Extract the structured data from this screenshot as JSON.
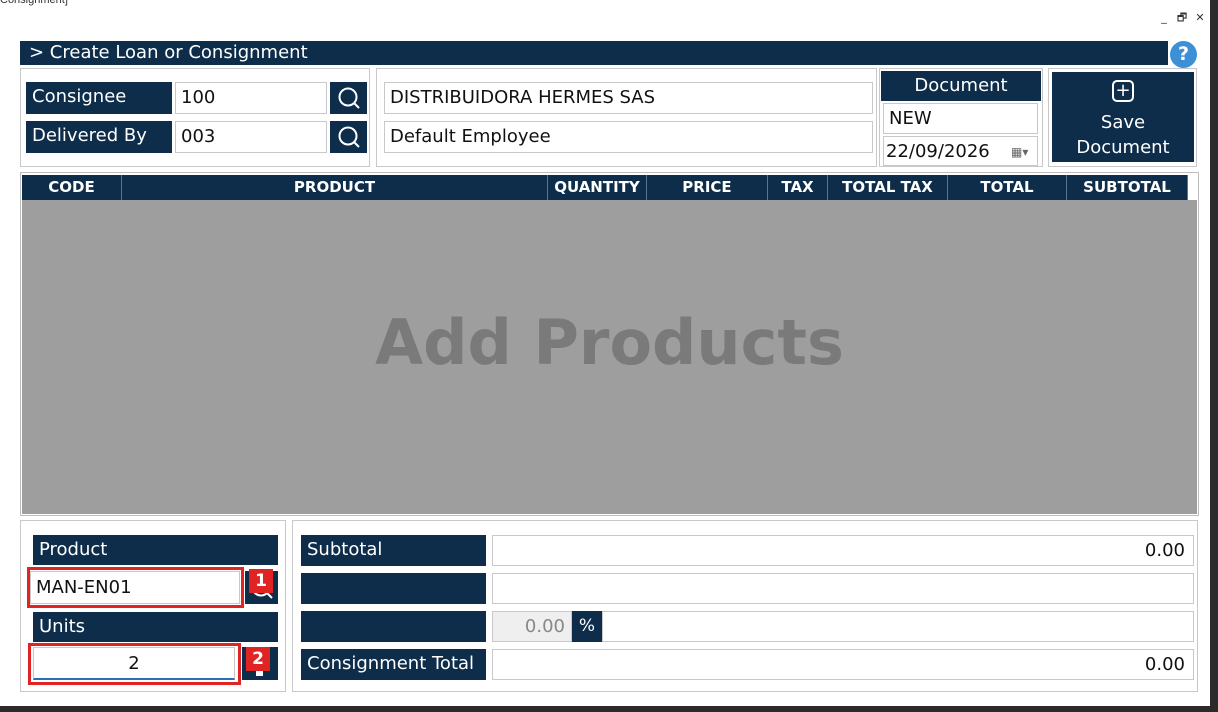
{
  "window": {
    "title": "Consignment]",
    "minimize": "_",
    "restore": "🗗",
    "close": "✕"
  },
  "header": {
    "title": "> Create Loan or Consignment",
    "help": "?"
  },
  "consignee": {
    "label": "Consignee",
    "code": "100",
    "name": "DISTRIBUIDORA HERMES SAS"
  },
  "delivered_by": {
    "label": "Delivered By",
    "code": "003",
    "name": "Default Employee"
  },
  "document": {
    "label": "Document",
    "number": "NEW",
    "date": "22/09/2026"
  },
  "save": {
    "icon": "⊕",
    "label_line1": "Save",
    "label_line2": "Document"
  },
  "grid": {
    "columns": [
      "CODE",
      "PRODUCT",
      "QUANTITY",
      "PRICE",
      "TAX",
      "TOTAL TAX",
      "TOTAL",
      "SUBTOTAL"
    ],
    "empty_text": "Add Products"
  },
  "entry": {
    "product_label": "Product",
    "product_value": "MAN-EN01",
    "units_label": "Units",
    "units_value": "2",
    "badge1": "1",
    "badge2": "2"
  },
  "totals": {
    "subtotal_label": "Subtotal",
    "subtotal_value": "0.00",
    "discount_value": "0.00",
    "percent_symbol": "%",
    "total_label": "Consignment Total",
    "total_value": "0.00"
  },
  "colors": {
    "navy": "#0d2d4a",
    "highlight_red": "#e02424",
    "grid_gray": "#9e9e9e"
  }
}
